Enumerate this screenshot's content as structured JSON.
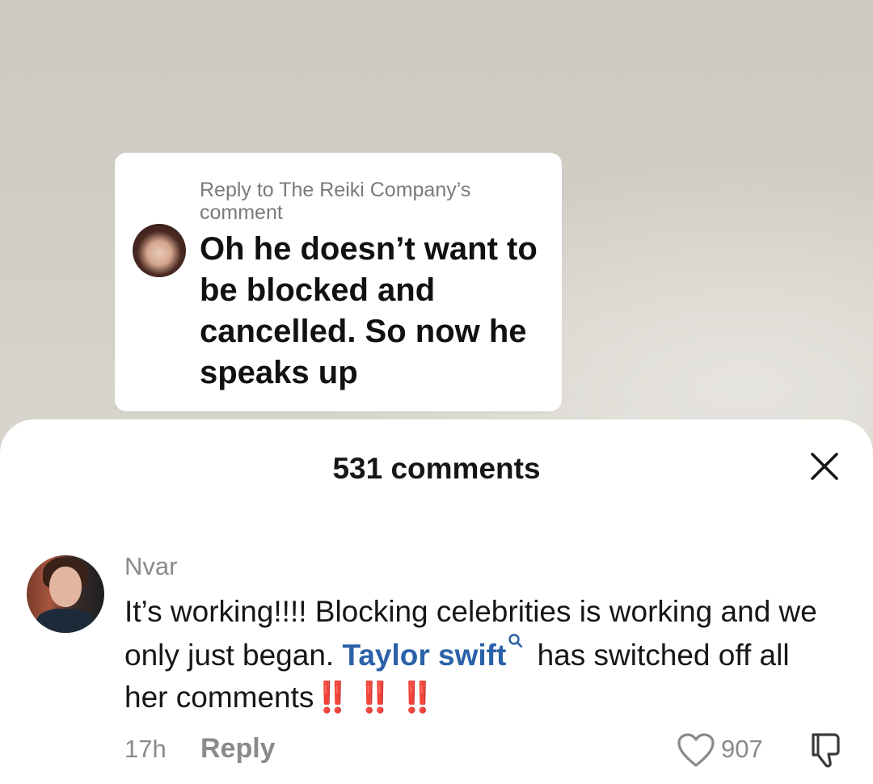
{
  "video": {
    "reply_card": {
      "header": "Reply to The Reiki Company’s comment",
      "text": "Oh he doesn’t want to be blocked and cancelled. So now he speaks up"
    }
  },
  "comments_sheet": {
    "title": "531 comments",
    "close_icon": "close-icon",
    "comment": {
      "username": "Nvar",
      "text_before": "It’s working!!!! Blocking celebrities is working and we only just began. ",
      "mention": "Taylor swift",
      "text_after": " has switched off all her comments",
      "emphasis": "‼️ ‼️ ‼️",
      "time": "17h",
      "reply_label": "Reply",
      "like_count": "907",
      "like_icon": "heart-icon",
      "dislike_icon": "thumbs-down-icon"
    }
  },
  "colors": {
    "mention": "#2b61a8",
    "muted": "#8a8a8a",
    "emphasis": "#e0312a"
  }
}
